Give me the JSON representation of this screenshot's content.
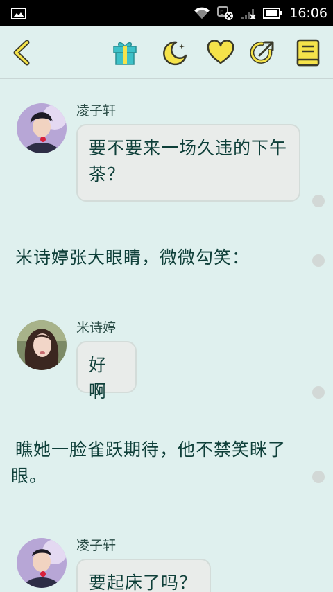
{
  "status_bar": {
    "time": "16:06",
    "icons": [
      "gallery-icon",
      "wifi-icon",
      "data-off-icon",
      "signal-icon",
      "battery-icon"
    ]
  },
  "toolbar": {
    "icons": [
      "back-icon",
      "gift-icon",
      "moon-icon",
      "heart-icon",
      "share-icon",
      "book-icon"
    ],
    "accent": "#f5e34a"
  },
  "messages": [
    {
      "type": "chat",
      "speaker": "凌子轩",
      "text": "要不要来一场久违的下午茶？"
    },
    {
      "type": "narration",
      "text": "米诗婷张大眼睛，微微勾笑："
    },
    {
      "type": "chat",
      "speaker": "米诗婷",
      "text": "好啊"
    },
    {
      "type": "narration",
      "text": "瞧她一脸雀跃期待，他不禁笑眯了眼。"
    },
    {
      "type": "chat",
      "speaker": "凌子轩",
      "text": "要起床了吗？"
    }
  ]
}
